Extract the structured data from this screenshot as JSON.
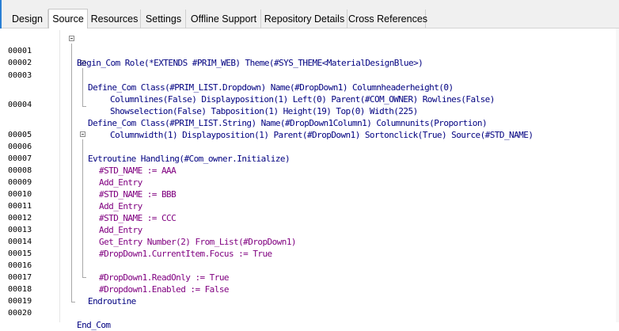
{
  "tabs": [
    {
      "label": "Design"
    },
    {
      "label": "Source"
    },
    {
      "label": "Resources"
    },
    {
      "label": "Settings"
    },
    {
      "label": "Offline Support"
    },
    {
      "label": "Repository Details"
    },
    {
      "label": "Cross References"
    }
  ],
  "active_tab": "Source",
  "lines": [
    {
      "num": "00001",
      "code": "Begin_Com Role(*EXTENDS #PRIM_WEB) Theme(#SYS_THEME<MaterialDesignBlue>)"
    },
    {
      "num": "00002",
      "code": ""
    },
    {
      "num": "00003",
      "code": "Define_Com Class(#PRIM_LIST.Dropdown) Name(#DropDown1) Columnheaderheight(0)"
    },
    {
      "num": "",
      "code": "Columnlines(False) Displayposition(1) Left(0) Parent(#COM_OWNER) Rowlines(False)"
    },
    {
      "num": "",
      "code": "Showselection(False) Tabposition(1) Height(19) Top(0) Width(225)"
    },
    {
      "num": "00004",
      "code": "Define_Com Class(#PRIM_LIST.String) Name(#DropDown1Column1) Columnunits(Proportion)"
    },
    {
      "num": "",
      "code": "Columnwidth(1) Displayposition(1) Parent(#DropDown1) Sortonclick(True) Source(#STD_NAME)"
    },
    {
      "num": "00005",
      "code": ""
    },
    {
      "num": "00006",
      "code": "Evtroutine Handling(#Com_owner.Initialize)"
    },
    {
      "num": "00007",
      "code": "#STD_NAME := AAA"
    },
    {
      "num": "00008",
      "code": "Add_Entry"
    },
    {
      "num": "00009",
      "code": "#STD_NAME := BBB"
    },
    {
      "num": "00010",
      "code": "Add_Entry"
    },
    {
      "num": "00011",
      "code": "#STD_NAME := CCC"
    },
    {
      "num": "00012",
      "code": "Add_Entry"
    },
    {
      "num": "00013",
      "code": "Get_Entry Number(2) From_List(#DropDown1)"
    },
    {
      "num": "00014",
      "code": "#DropDown1.CurrentItem.Focus := True"
    },
    {
      "num": "00015",
      "code": ""
    },
    {
      "num": "00016",
      "code": "#DropDown1.ReadOnly := True"
    },
    {
      "num": "00017",
      "code": "#Dropdown1.Enabled := False"
    },
    {
      "num": "00018",
      "code": "Endroutine"
    },
    {
      "num": "00019",
      "code": ""
    },
    {
      "num": "00020",
      "code": "End_Com"
    }
  ],
  "colors": {
    "keyword": "#000080",
    "statement": "#800080",
    "line_number": "#000000",
    "tab_bar": "#f0f0f0"
  },
  "icons": [
    "fold-collapse-icon"
  ]
}
